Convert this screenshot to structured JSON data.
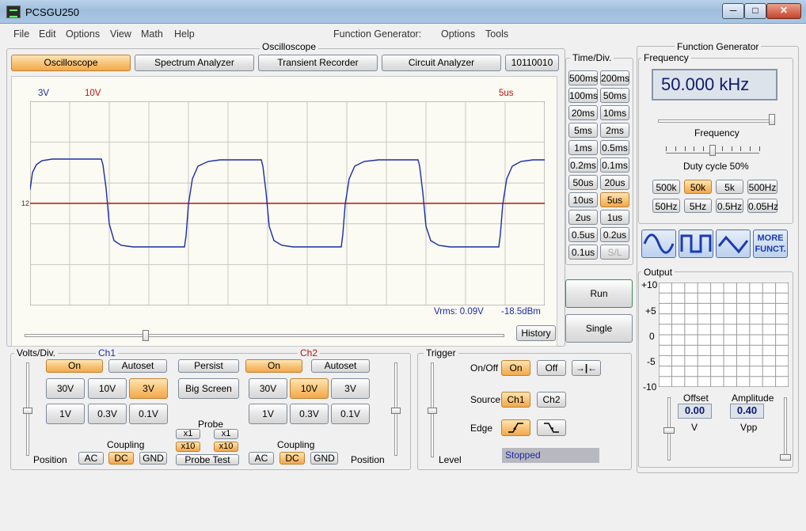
{
  "window": {
    "title": "PCSGU250",
    "min": "─",
    "max": "□",
    "close": "✕"
  },
  "menu": {
    "items": [
      "File",
      "Edit",
      "Options",
      "View",
      "Math",
      "Help"
    ],
    "fg_items": [
      "Function Generator:",
      "Options",
      "Tools"
    ]
  },
  "oscilloscope": {
    "group_title": "Oscilloscope",
    "tabs": [
      "Oscilloscope",
      "Spectrum Analyzer",
      "Transient Recorder",
      "Circuit Analyzer",
      "10110010"
    ],
    "active_tab": 0,
    "ch1_scale": "3V",
    "ch2_scale": "10V",
    "time_scale": "5us",
    "vrms": "Vrms: 0.09V",
    "dbm": "-18.5dBm",
    "marker": "12",
    "history_label": "History"
  },
  "timediv": {
    "title": "Time/Div.",
    "buttons": [
      "500ms",
      "200ms",
      "100ms",
      "50ms",
      "20ms",
      "10ms",
      "5ms",
      "2ms",
      "1ms",
      "0.5ms",
      "0.2ms",
      "0.1ms",
      "50us",
      "20us",
      "10us",
      "5us",
      "2us",
      "1us",
      "0.5us",
      "0.2us",
      "0.1us",
      "S/L"
    ],
    "active": "5us",
    "disabled": "S/L"
  },
  "run_label": "Run",
  "single_label": "Single",
  "volts": {
    "title": "Volts/Div.",
    "ch1": "Ch1",
    "ch2": "Ch2",
    "on": "On",
    "autoset": "Autoset",
    "persist": "Persist",
    "big_screen": "Big Screen",
    "ranges_top": [
      "30V",
      "10V",
      "3V"
    ],
    "ranges_bottom": [
      "1V",
      "0.3V",
      "0.1V"
    ],
    "ch1_active": "3V",
    "ch2_active": "10V",
    "probe": "Probe",
    "x1": "x1",
    "x10": "x10",
    "probe_test": "Probe Test",
    "coupling": "Coupling",
    "ac": "AC",
    "dc": "DC",
    "gnd": "GND",
    "position": "Position"
  },
  "trigger": {
    "title": "Trigger",
    "onoff": "On/Off",
    "on": "On",
    "off": "Off",
    "source": "Source",
    "ch1": "Ch1",
    "ch2": "Ch2",
    "edge": "Edge",
    "level": "Level",
    "status": "Stopped"
  },
  "fg": {
    "title": "Function Generator",
    "frequency_title": "Frequency",
    "frequency_value": "50.000 kHz",
    "frequency_label": "Frequency",
    "duty_label": "Duty cycle 50%",
    "duty_value": 0.5,
    "freq_buttons": [
      "500k",
      "50k",
      "5k",
      "500Hz",
      "50Hz",
      "5Hz",
      "0.5Hz",
      "0.05Hz"
    ],
    "freq_active": "50k",
    "more": "MORE FUNCT."
  },
  "output": {
    "title": "Output",
    "yticks": [
      "+10",
      "+5",
      "0",
      "-5",
      "-10"
    ],
    "offset_label": "Offset",
    "offset_value": "0.00",
    "offset_unit": "V",
    "amplitude_label": "Amplitude",
    "amplitude_value": "0.40",
    "amplitude_unit": "Vpp"
  },
  "colors": {
    "ch1": "#1c2ca8",
    "ch2": "#c01010",
    "active": "#f7b865"
  }
}
